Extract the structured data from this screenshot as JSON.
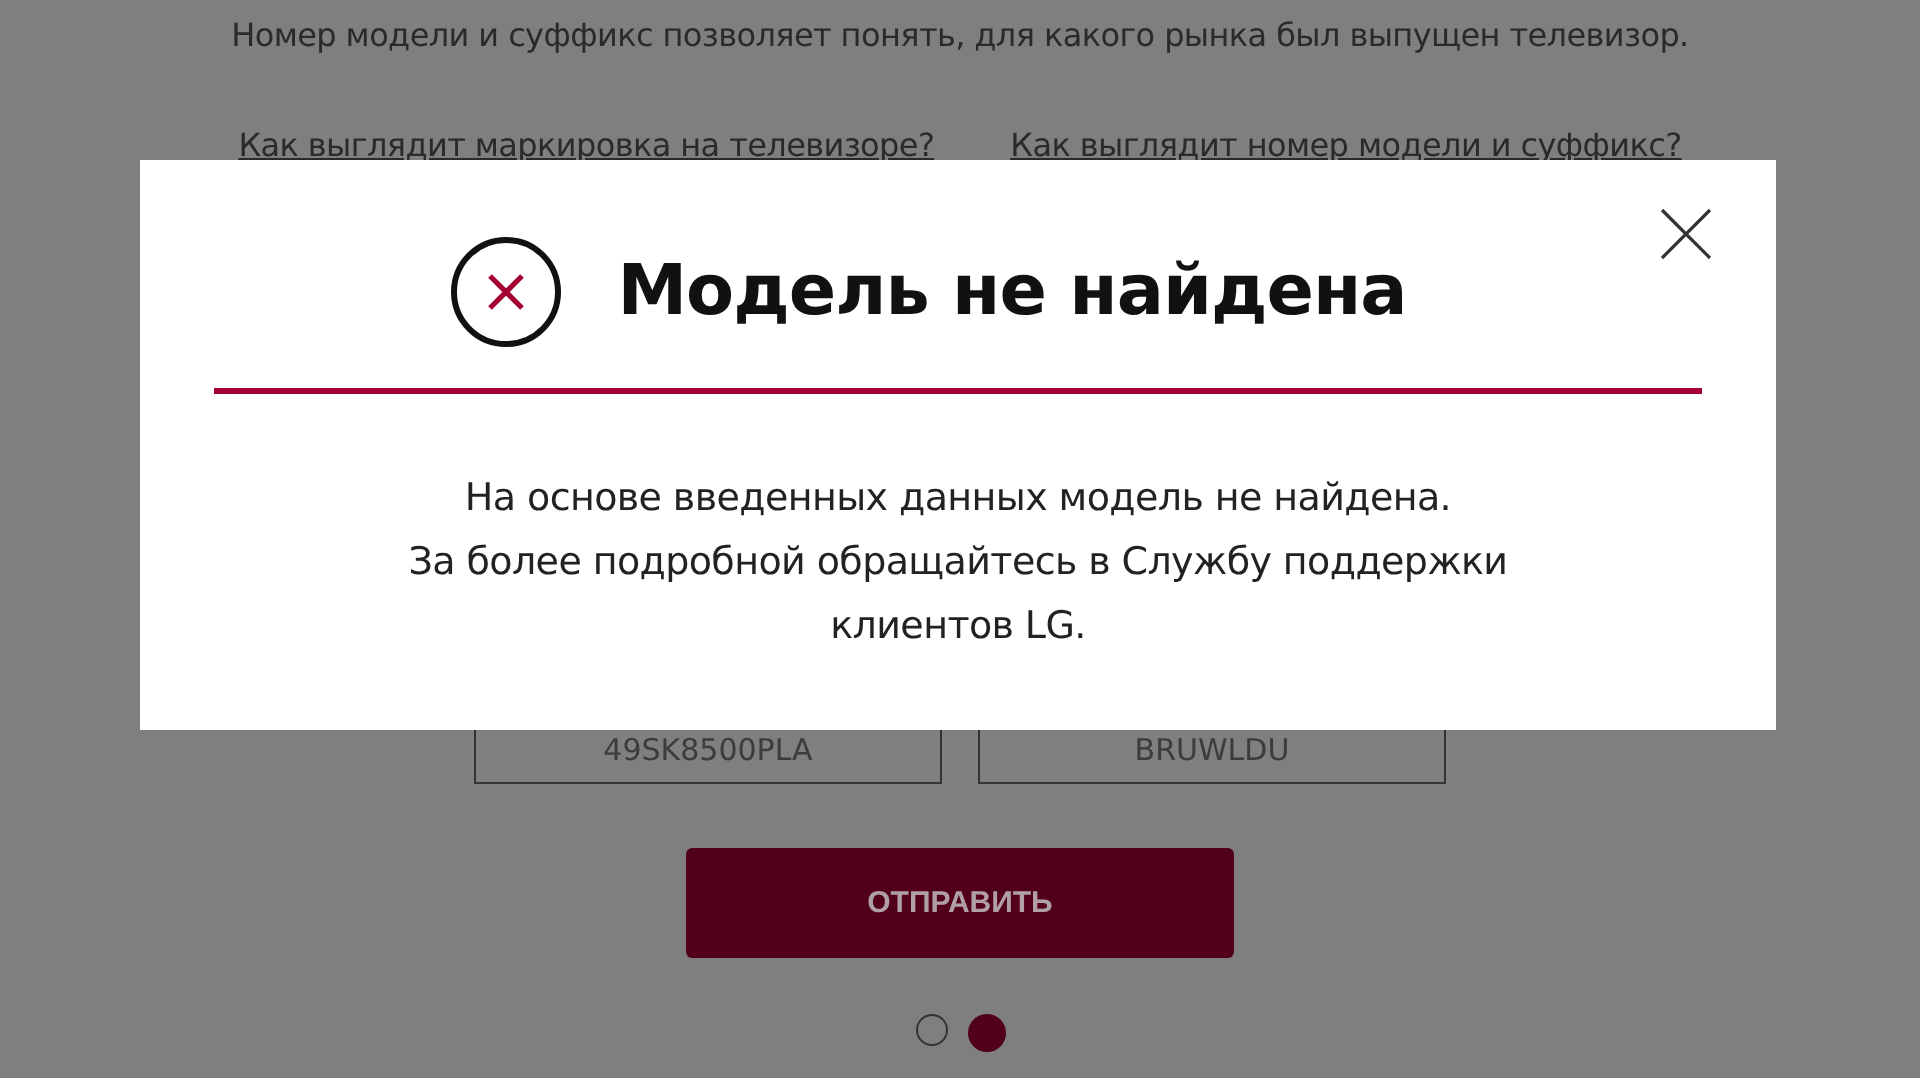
{
  "page": {
    "intro": "Номер модели и суффикс позволяет понять, для какого рынка был выпущен телевизор.",
    "links": [
      "Как выглядит маркировка на телевизоре?",
      "Как выглядит номер модели и суффикс?"
    ],
    "fields": [
      {
        "value": "49SK8500PLA"
      },
      {
        "value": "BRUWLDU"
      }
    ],
    "submit": "ОТПРАВИТЬ",
    "steps": [
      {
        "selected": false
      },
      {
        "selected": true
      }
    ]
  },
  "dialog": {
    "title": "Модель не найдена",
    "message": [
      "На основе введенных данных модель не найдена.",
      "За более подробной обращайтесь в Службу поддержки клиентов LG."
    ]
  }
}
